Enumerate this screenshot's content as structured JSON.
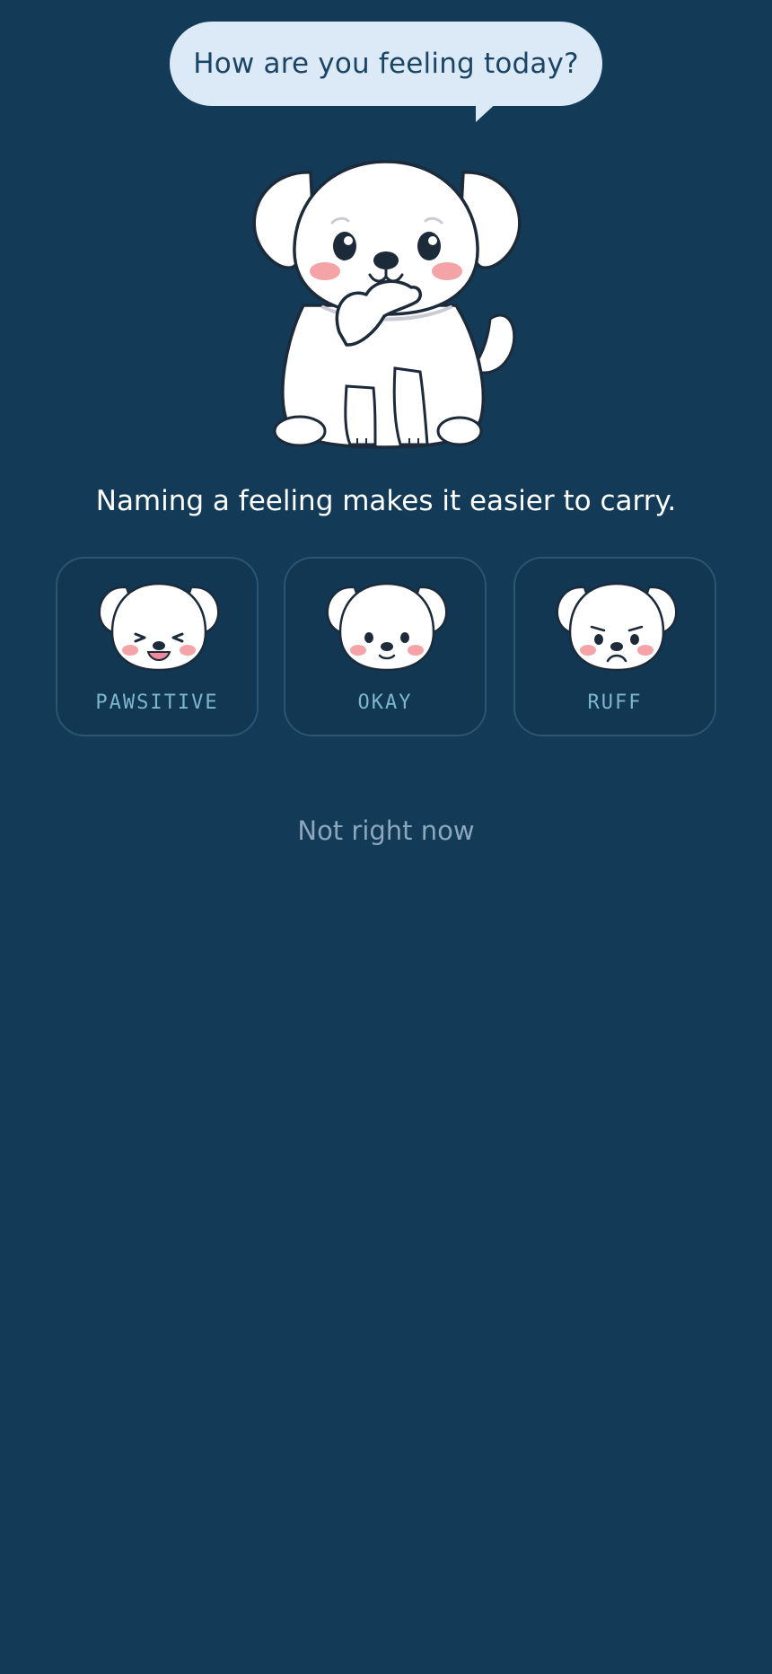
{
  "prompt": {
    "question": "How are you feeling today?"
  },
  "tagline": "Naming a feeling makes it easier to carry.",
  "moods": [
    {
      "label": "PAWSITIVE",
      "icon": "happy-dog-face-icon"
    },
    {
      "label": "OKAY",
      "icon": "neutral-dog-face-icon"
    },
    {
      "label": "RUFF",
      "icon": "sad-dog-face-icon"
    }
  ],
  "skip_label": "Not right now",
  "colors": {
    "background": "#133a57",
    "bubble": "#dceaf7",
    "card_border": "#2a5574",
    "mood_label": "#7cb6cf",
    "skip_text": "#8aa7bd"
  }
}
